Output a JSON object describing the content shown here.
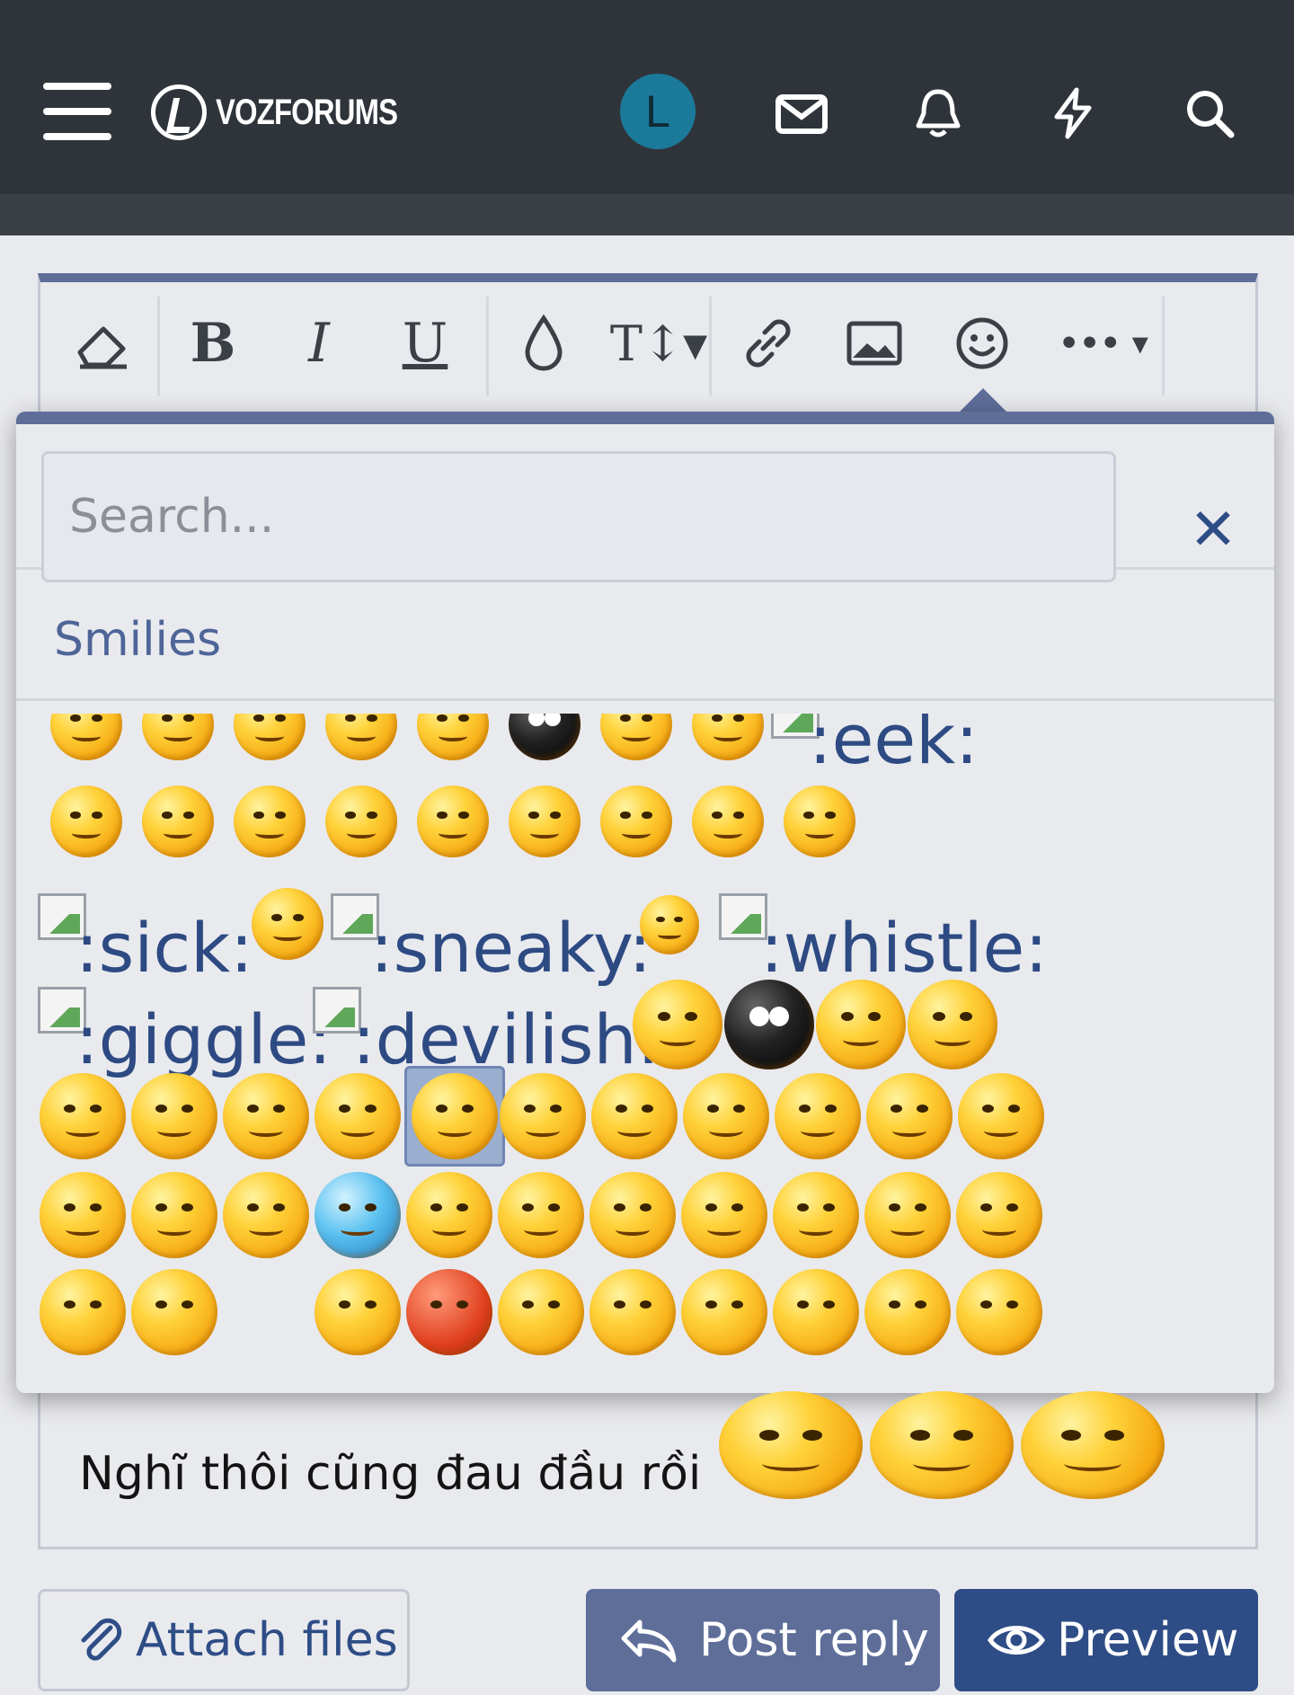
{
  "header": {
    "logo_text": "VOZFORUMS",
    "avatar_initial": "L",
    "icons": [
      "menu-icon",
      "envelope-icon",
      "bell-icon",
      "lightning-icon",
      "search-icon"
    ]
  },
  "toolbar": {
    "buttons": [
      "eraser-icon",
      "bold-icon",
      "italic-icon",
      "underline-icon",
      "color-drop-icon",
      "text-size-icon",
      "link-icon",
      "image-icon",
      "smiley-icon",
      "more-icon"
    ],
    "bold_label": "B",
    "italic_label": "I",
    "underline_label": "U",
    "textsize_label": "T↕▾",
    "more_label": "••• ▾"
  },
  "smilie_picker": {
    "search_placeholder": "Search...",
    "close_label": "✕",
    "section_title": "Smilies",
    "codes": {
      "eek": ":eek:",
      "sick": ":sick:",
      "sneaky": ":sneaky:",
      "whistle": ":whistle:",
      "giggle": ":giggle:",
      "devilish": ":devilish:"
    }
  },
  "editor_content": {
    "text": "Nghĩ thôi cũng đau đầu rồi"
  },
  "actions": {
    "attach_label": "Attach files",
    "post_label": "Post reply",
    "preview_label": "Preview"
  },
  "colors": {
    "header_bg": "#2f343b",
    "accent": "#5e6e99",
    "primary": "#2e4d86",
    "avatar_bg": "#1b7a9a"
  }
}
